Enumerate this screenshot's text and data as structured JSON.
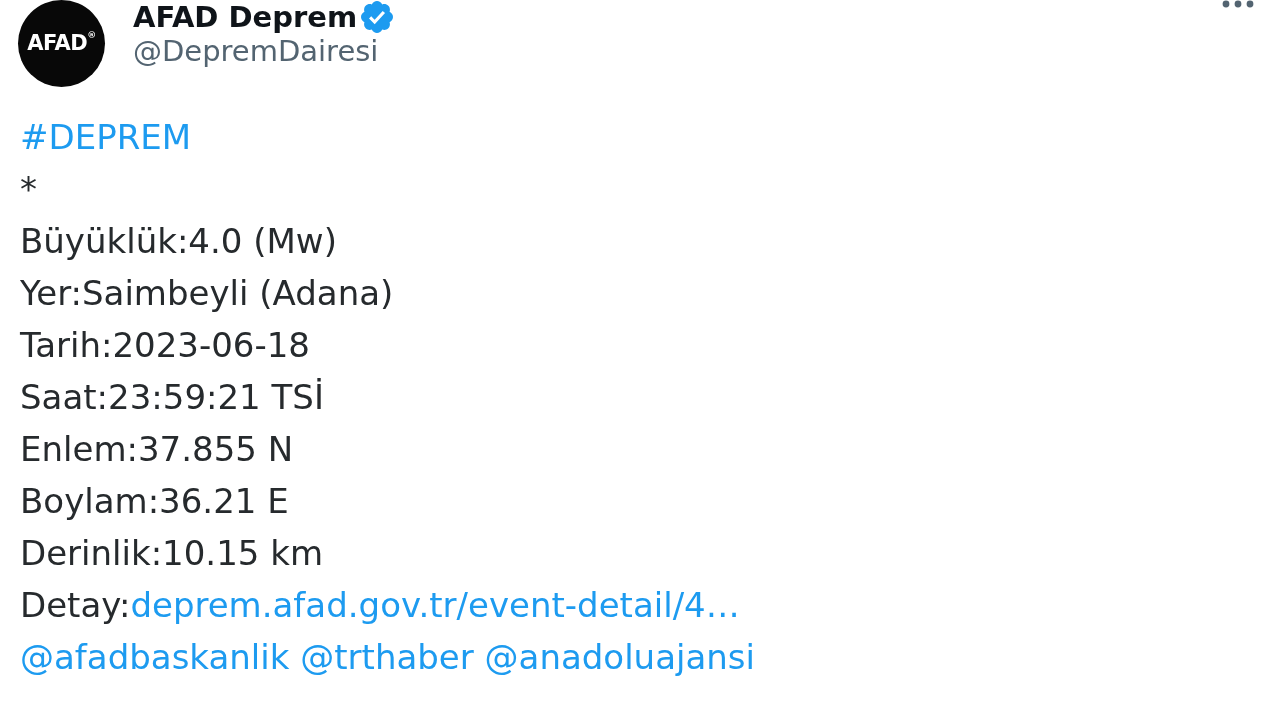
{
  "tweet": {
    "author": {
      "avatar_text": "AFAD$^{®}$",
      "name": "AFAD Deprem",
      "verified": true,
      "handle": "@DepremDairesi"
    },
    "lines": [
      [
        {
          "kind": "hashtag",
          "text": "#DEPREM"
        }
      ],
      [
        {
          "kind": "text",
          "text": "*"
        }
      ],
      [
        {
          "kind": "text",
          "text": "Büyüklük:4.0 (Mw)"
        }
      ],
      [
        {
          "kind": "text",
          "text": "Yer:Saimbeyli (Adana)"
        }
      ],
      [
        {
          "kind": "text",
          "text": "Tarih:2023-06-18"
        }
      ],
      [
        {
          "kind": "text",
          "text": "Saat:23:59:21 TSİ"
        }
      ],
      [
        {
          "kind": "text",
          "text": "Enlem:37.855 N"
        }
      ],
      [
        {
          "kind": "text",
          "text": "Boylam:36.21 E"
        }
      ],
      [
        {
          "kind": "text",
          "text": "Derinlik:10.15 km"
        }
      ],
      [
        {
          "kind": "text",
          "text": "Detay:"
        },
        {
          "kind": "link",
          "text": "deprem.afad.gov.tr/event-detail/4…"
        }
      ],
      [
        {
          "kind": "mention",
          "text": "@afadbaskanlik"
        },
        {
          "kind": "mention",
          "text": "@trthaber"
        },
        {
          "kind": "mention",
          "text": "@anadoluajansi"
        }
      ]
    ]
  }
}
